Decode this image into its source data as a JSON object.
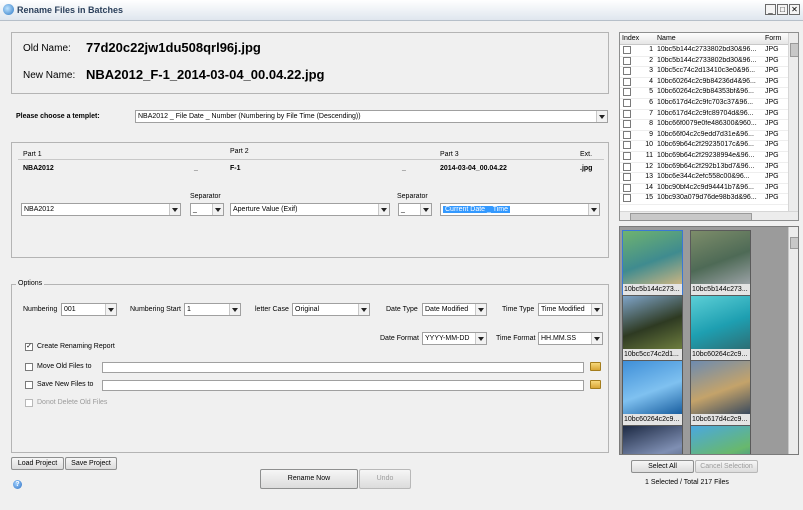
{
  "window": {
    "title": "Rename Files in Batches",
    "controls": [
      "_",
      "□",
      "✕"
    ]
  },
  "preview": {
    "old_label": "Old Name:",
    "old_value": "77d20c22jw1du508qrl96j.jpg",
    "new_label": "New Name:",
    "new_value": "NBA2012_F-1_2014-03-04_00.04.22.jpg"
  },
  "template": {
    "label": "Please choose a templet:",
    "value": "NBA2012 _ File Date _ Number (Numbering by File Time (Descending))"
  },
  "parts": {
    "headers": {
      "part1": "Part 1",
      "part2": "Part 2",
      "part3": "Part 3",
      "ext": "Ext."
    },
    "values": {
      "part1": "NBA2012",
      "sep1": "_",
      "part2": "F-1",
      "sep2": "_",
      "part3": "2014-03-04_00.04.22",
      "ext": ".jpg"
    },
    "separator_label": "Separator",
    "combos": {
      "part1": "NBA2012",
      "sep1": "_",
      "part2": "Aperture Value (Exif)",
      "sep2": "_",
      "part3": "Current Date _ Time"
    }
  },
  "options": {
    "legend": "Options",
    "numbering_label": "Numbering",
    "numbering_value": "001",
    "numbering_start_label": "Numbering Start",
    "numbering_start_value": "1",
    "letter_case_label": "letter Case",
    "letter_case_value": "Original",
    "date_type_label": "Date Type",
    "date_type_value": "Date Modified",
    "time_type_label": "Time Type",
    "time_type_value": "Time Modified",
    "date_format_label": "Date Format",
    "date_format_value": "YYYY-MM-DD",
    "time_format_label": "Time Format",
    "time_format_value": "HH.MM.SS",
    "create_report_label": "Create Renaming Report",
    "create_report_checked": true,
    "move_old_label": "Move Old Files to",
    "move_old_checked": false,
    "save_new_label": "Save New Files to",
    "save_new_checked": false,
    "donot_delete_label": "Donot Delete Old Files",
    "donot_delete_checked": false
  },
  "buttons": {
    "load_project": "Load Project",
    "save_project": "Save Project",
    "rename_now": "Rename Now",
    "undo": "Undo",
    "select_all": "Select All",
    "cancel_selection": "Cancel Selection",
    "help": "?"
  },
  "file_list": {
    "headers": {
      "index": "Index",
      "name": "Name",
      "format": "Form"
    },
    "rows": [
      {
        "index": "1",
        "name": "10bc5b144c2733802bd30&96...",
        "format": "JPG"
      },
      {
        "index": "2",
        "name": "10bc5b144c2733802bd30&96...",
        "format": "JPG"
      },
      {
        "index": "3",
        "name": "10bc5cc74c2d13410c3e0&96...",
        "format": "JPG"
      },
      {
        "index": "4",
        "name": "10bc60264c2c9b84236d4&96...",
        "format": "JPG"
      },
      {
        "index": "5",
        "name": "10bc60264c2c9b84353bf&96...",
        "format": "JPG"
      },
      {
        "index": "6",
        "name": "10bc617d4c2c9fc703c37&96...",
        "format": "JPG"
      },
      {
        "index": "7",
        "name": "10bc617d4c2c9fc89704d&96...",
        "format": "JPG"
      },
      {
        "index": "8",
        "name": "10bc66f0079e0fe486300&960...",
        "format": "JPG"
      },
      {
        "index": "9",
        "name": "10bc66f04c2c9edd7d31e&96...",
        "format": "JPG"
      },
      {
        "index": "10",
        "name": "10bc69b64c2f29235017c&96...",
        "format": "JPG"
      },
      {
        "index": "11",
        "name": "10bc69b64c2f29238994e&96...",
        "format": "JPG"
      },
      {
        "index": "12",
        "name": "10bc69b64c2f292b13bd7&96...",
        "format": "JPG"
      },
      {
        "index": "13",
        "name": "10bc6e344c2efc558c00&96...",
        "format": "JPG"
      },
      {
        "index": "14",
        "name": "10bc90bf4c2c9d94441b7&96...",
        "format": "JPG"
      },
      {
        "index": "15",
        "name": "10bc930a079d76de98b3d&96...",
        "format": "JPG"
      }
    ]
  },
  "thumbnails": [
    {
      "caption": "10bc5b144c273...",
      "colors": [
        "#6fb36f",
        "#3f8b8f",
        "#c9b482"
      ]
    },
    {
      "caption": "10bc5b144c273...",
      "colors": [
        "#7d8d6a",
        "#4e6a56",
        "#9aa1a5"
      ]
    },
    {
      "caption": "10bc5cc74c2d1...",
      "colors": [
        "#7fa4c8",
        "#2e3a22",
        "#6d7d3e"
      ]
    },
    {
      "caption": "10bc60264c2c9...",
      "colors": [
        "#5ccfd6",
        "#1e9fb1",
        "#2d6e74"
      ]
    },
    {
      "caption": "10bc60264c2c9...",
      "colors": [
        "#3f8fd8",
        "#7fc1f0",
        "#1a5fa0"
      ]
    },
    {
      "caption": "10bc617d4c2c9...",
      "colors": [
        "#6d8bb0",
        "#c4a36a",
        "#3b4b5e"
      ]
    },
    {
      "caption": "",
      "colors": [
        "#1d2a44",
        "#7f8fb3",
        "#39455c"
      ]
    },
    {
      "caption": "",
      "colors": [
        "#4aa8e0",
        "#68b86d",
        "#1f6fb0"
      ]
    }
  ],
  "status": "1 Selected / Total 217 Files"
}
